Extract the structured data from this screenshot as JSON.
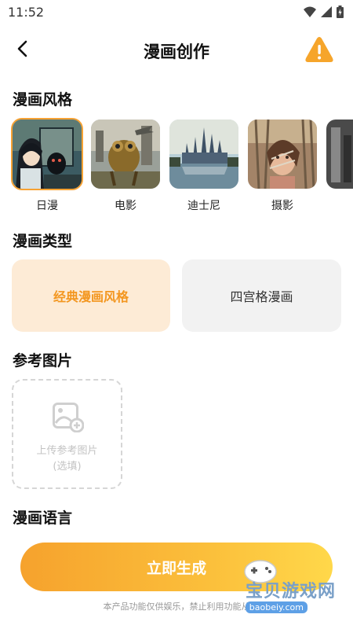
{
  "status_bar": {
    "time": "11:52"
  },
  "header": {
    "title": "漫画创作"
  },
  "style_section": {
    "title": "漫画风格",
    "items": [
      {
        "label": "日漫",
        "selected": true
      },
      {
        "label": "电影",
        "selected": false
      },
      {
        "label": "迪士尼",
        "selected": false
      },
      {
        "label": "摄影",
        "selected": false
      }
    ]
  },
  "type_section": {
    "title": "漫画类型",
    "options": [
      {
        "label": "经典漫画风格",
        "selected": true
      },
      {
        "label": "四宫格漫画",
        "selected": false
      }
    ]
  },
  "reference_section": {
    "title": "参考图片",
    "upload_label": "上传参考图片",
    "upload_hint": "(选填)"
  },
  "language_section": {
    "title": "漫画语言"
  },
  "actions": {
    "generate_label": "立即生成"
  },
  "disclaimer": "本产品功能仅供娱乐，禁止利用功能从",
  "watermark": {
    "main": "宝贝游戏网",
    "sub": "baobeiy.com"
  },
  "colors": {
    "accent": "#f7a233",
    "accent_bg": "#fdebd6",
    "warning": "#f6a52b"
  }
}
